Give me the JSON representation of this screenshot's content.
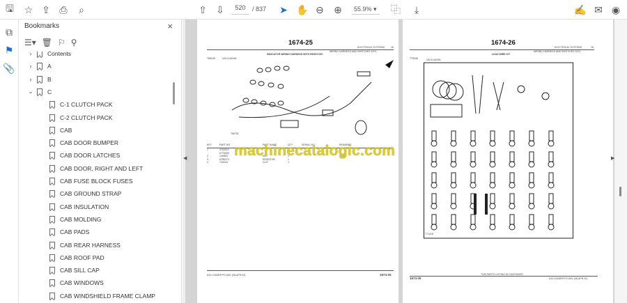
{
  "toolbar": {
    "page_current": "520",
    "page_total": "/ 837",
    "zoom": "55.9%",
    "icons": [
      "save-icon",
      "bookmark-star-icon",
      "upload-icon",
      "print-icon",
      "search-icon",
      "prev-page-icon",
      "next-page-icon",
      "select-cursor-icon",
      "hand-icon",
      "zoom-out-icon",
      "zoom-in-icon",
      "fit-page-icon",
      "scroll-mode-icon",
      "sign-icon",
      "mail-icon",
      "account-icon"
    ]
  },
  "bookmarks": {
    "title": "Bookmarks",
    "close": "×",
    "items": [
      {
        "label": "Contents",
        "level": 0,
        "expanded": false
      },
      {
        "label": "A",
        "level": 0,
        "expanded": false
      },
      {
        "label": "B",
        "level": 0,
        "expanded": false
      },
      {
        "label": "C",
        "level": 0,
        "expanded": true
      },
      {
        "label": "C-1 CLUTCH PACK",
        "level": 1
      },
      {
        "label": "C-2 CLUTCH PACK",
        "level": 1
      },
      {
        "label": "CAB",
        "level": 1
      },
      {
        "label": "CAB DOOR BUMPER",
        "level": 1
      },
      {
        "label": "CAB DOOR LATCHES",
        "level": 1
      },
      {
        "label": "CAB DOOR, RIGHT AND LEFT",
        "level": 1
      },
      {
        "label": "CAB FUSE BLOCK FUSES",
        "level": 1
      },
      {
        "label": "CAB GROUND STRAP",
        "level": 1
      },
      {
        "label": "CAB INSULATION",
        "level": 1
      },
      {
        "label": "CAB MOLDING",
        "level": 1
      },
      {
        "label": "CAB PADS",
        "level": 1
      },
      {
        "label": "CAB REAR HARNESS",
        "level": 1
      },
      {
        "label": "CAB ROOF PAD",
        "level": 1
      },
      {
        "label": "CAB SILL CAP",
        "level": 1
      },
      {
        "label": "CAB WINDOWS",
        "level": 1
      },
      {
        "label": "CAB WINDSHIELD FRAME CLAMP",
        "level": 1
      }
    ]
  },
  "pages": {
    "left": {
      "number": "1674-25",
      "section": "ELECTRICAL SYSTEMS",
      "section_no": "16",
      "subsection": "WIRING HARNESS AND SWITCHES 1674",
      "figure_title": "INDICATOR WIRING HARNESS WITH RESISTOR",
      "ref": "T86045",
      "ref2": "UN-01JAN94",
      "fig_label": "T86761",
      "table_headers": [
        "KEY",
        "PART NO.",
        "PART NAME",
        "QTY",
        "SERIAL NO.",
        "REMARKS"
      ],
      "rows": [
        [
          "1",
          "AT94510",
          "",
          "1",
          "",
          ""
        ],
        [
          "",
          "AT74539",
          "",
          "",
          "",
          ""
        ],
        [
          "2",
          "14H800",
          "NUT",
          "1",
          "",
          "3/16\""
        ],
        [
          "3",
          "AT56374",
          "RESISTOR",
          "1",
          "",
          ""
        ],
        [
          "4",
          "T33044",
          "CLIP",
          "1",
          "",
          ""
        ]
      ],
      "footer_left": "644 LOADER   PC1601   (08-APR-92)",
      "footer_right": "1674-25"
    },
    "right": {
      "number": "1674-26",
      "section": "ELECTRICAL SYSTEMS",
      "section_no": "16",
      "subsection": "WIRING HARNESS AND SWITCHES 1674",
      "figure_title": "LEAD WIRE KIT",
      "ref": "T75098",
      "ref2": "UN-01JAN94",
      "fig_label": "T71416",
      "footer_left": "1674-26",
      "footer_center": "THIS PARTS LISTING IS CONTINUED",
      "footer_right": "644 LOADER   PC1601   (08-APR-92)"
    }
  },
  "watermark": "machinecatalogic.com"
}
